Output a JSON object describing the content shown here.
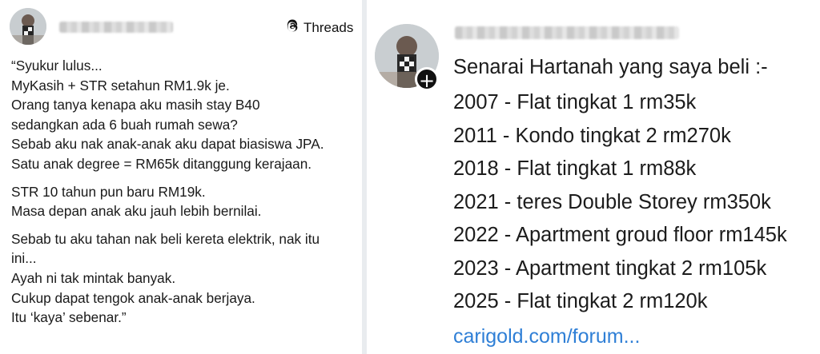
{
  "left_post": {
    "badge_label": "Threads",
    "paragraphs": [
      [
        "“Syukur lulus...",
        "MyKasih + STR setahun RM1.9k je.",
        "Orang tanya kenapa aku masih stay B40",
        "sedangkan ada 6 buah rumah sewa?",
        "Sebab aku nak anak-anak aku dapat biasiswa JPA.",
        "Satu anak degree = RM65k ditanggung kerajaan."
      ],
      [
        "STR 10 tahun pun baru RM19k.",
        "Masa depan anak aku jauh lebih bernilai."
      ],
      [
        "Sebab tu aku tahan nak beli kereta elektrik, nak itu",
        "ini...",
        "Ayah ni tak mintak banyak.",
        "Cukup dapat tengok anak-anak berjaya.",
        "Itu ‘kaya’ sebenar.”"
      ]
    ]
  },
  "right_post": {
    "follow_symbol": "+",
    "title": "Senarai Hartanah yang saya beli :-",
    "items": [
      "2007 - Flat tingkat 1 rm35k",
      "2011 - Kondo tingkat 2 rm270k",
      "2018 - Flat tingkat 1 rm88k",
      "2021 - teres Double Storey rm350k",
      "2022 - Apartment groud floor rm145k",
      "2023 - Apartment tingkat 2 rm105k",
      "2025 - Flat tingkat 2 rm120k"
    ],
    "link_text": "carigold.com/forum..."
  },
  "icons": {
    "threads": "threads-logo-icon",
    "follow": "plus-icon"
  }
}
